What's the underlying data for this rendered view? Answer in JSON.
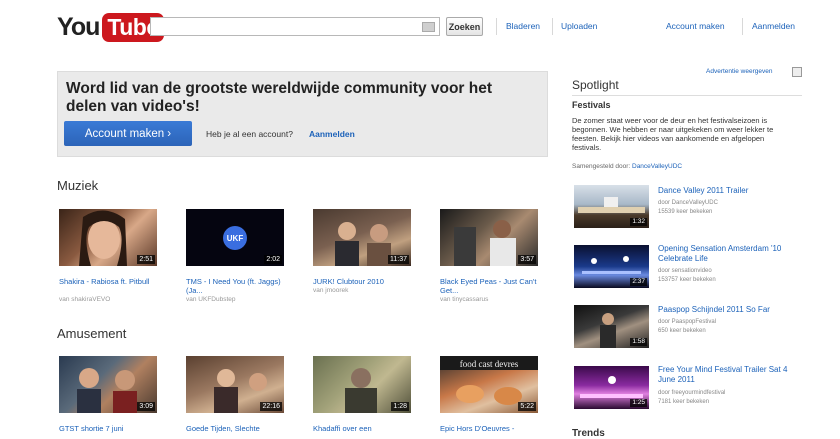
{
  "header": {
    "logo_you": "You",
    "logo_tube": "Tube",
    "search_value": "",
    "search_button": "Zoeken",
    "nav": {
      "browse": "Bladeren",
      "upload": "Uploaden",
      "create_account": "Account maken",
      "sign_in": "Aanmelden"
    }
  },
  "banner": {
    "title": "Word lid van de grootste wereldwijde community voor het delen van video's!",
    "cta": "Account maken ›",
    "have_account": "Heb je al een account?",
    "sign_in": "Aanmelden"
  },
  "music": {
    "title": "Muziek",
    "videos": [
      {
        "title": "Shakira - Rabiosa ft. Pitbull",
        "by": "van shakiraVEVO",
        "duration": "2:51"
      },
      {
        "title": "TMS - I Need You (ft. Jaggs) (Ja...",
        "by": "van UKFDubstep",
        "duration": "2:02"
      },
      {
        "title": "JURK! Clubtour 2010",
        "by": "van jmoorek",
        "duration": "11:37"
      },
      {
        "title": "Black Eyed Peas - Just Can't Get...",
        "by": "van tinycassarus",
        "duration": "3:57"
      }
    ]
  },
  "entertainment": {
    "title": "Amusement",
    "videos": [
      {
        "title": "GTST shortie 7 juni",
        "duration": "3:09"
      },
      {
        "title": "Goede Tijden, Slechte",
        "duration": "22:16"
      },
      {
        "title": "Khadaffi over een",
        "duration": "1:28"
      },
      {
        "title": "Epic Hors D'Oeuvres -",
        "duration": "5:22",
        "thumb_text": "food cast devres"
      }
    ]
  },
  "sidebar": {
    "ad_note": "Advertentie weergeven",
    "spotlight": "Spotlight",
    "subtitle": "Festivals",
    "description": "De zomer staat weer voor de deur en het festivalseizoen is begonnen. We hebben er naar uitgekeken om weer lekker te feesten. Bekijk hier videos van aankomende en afgelopen festivals.",
    "compiled_label": "Samengesteld door:",
    "compiled_by": "DanceValleyUDC",
    "videos": [
      {
        "title": "Dance Valley 2011 Trailer",
        "by": "door DanceValleyUDC",
        "views": "15539 keer bekeken",
        "duration": "1:32"
      },
      {
        "title": "Opening Sensation Amsterdam '10 Celebrate Life",
        "by": "door sensationvideo",
        "views": "153757 keer bekeken",
        "duration": "2:37"
      },
      {
        "title": "Paaspop Schijndel 2011 So Far",
        "by": "door PaaspopFestival",
        "views": "650 keer bekeken",
        "duration": "1:58"
      },
      {
        "title": "Free Your Mind Festival Trailer Sat 4 June 2011",
        "by": "door freeyourmindfestival",
        "views": "7181 keer bekeken",
        "duration": "1:25"
      }
    ],
    "trends": "Trends"
  }
}
